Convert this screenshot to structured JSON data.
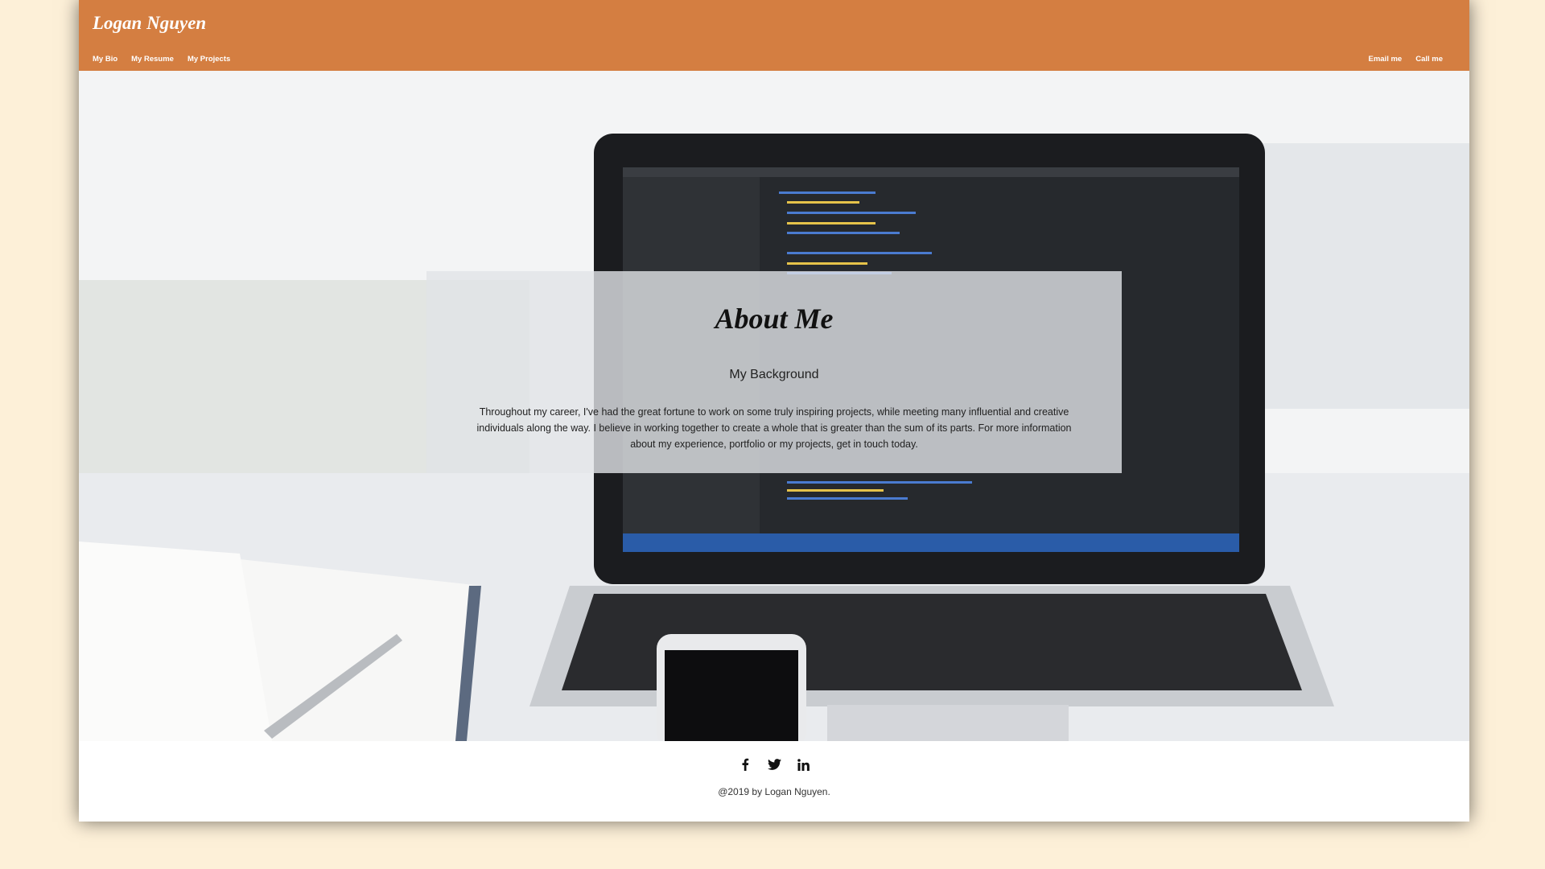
{
  "header": {
    "brand": "Logan Nguyen",
    "nav_left": [
      "My Bio",
      "My Resume",
      "My Projects"
    ],
    "nav_right": [
      "Email me",
      "Call me"
    ]
  },
  "about": {
    "title": "About Me",
    "subtitle": "My Background",
    "body": "Throughout my career, I've had the great fortune to work on some truly inspiring projects, while meeting many influential and creative individuals along the way. I believe in working together to create a whole that is greater than the sum of its parts. For more information about my experience, portfolio or my projects, get in touch today."
  },
  "footer": {
    "social_icons": [
      "facebook-icon",
      "twitter-icon",
      "linkedin-icon"
    ],
    "copyright": "@2019 by Logan Nguyen."
  },
  "colors": {
    "header_bg": "#d47e41",
    "page_bg": "#fdf0d8"
  }
}
